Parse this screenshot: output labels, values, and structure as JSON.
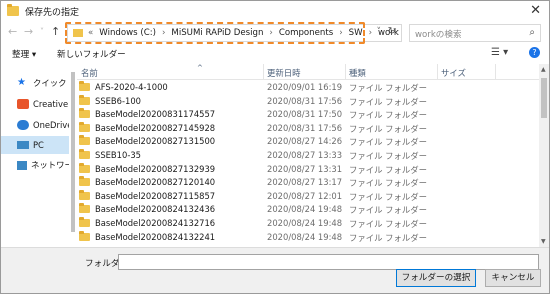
{
  "window": {
    "title": "保存先の指定",
    "close_glyph": "✕"
  },
  "nav": {
    "back": "←",
    "forward": "→",
    "dropdown": "˅",
    "up": "↑",
    "crumb_prefix": "«",
    "crumbs": [
      "Windows (C:)",
      "MiSUMi RAPiD Design",
      "Components",
      "SW",
      "work"
    ],
    "crumb_separator": "›",
    "addr_chevron": "˅",
    "refresh": "↻",
    "search_placeholder": "workの検索",
    "search_icon": "⌕"
  },
  "toolbar": {
    "organize": "整理 ▾",
    "new_folder": "新しいフォルダー",
    "view_icon": "☰ ▾",
    "help_icon": "?"
  },
  "sidebar": {
    "items": [
      {
        "label": "クイック アク",
        "icon": "star-icon",
        "color": "#1a73e8",
        "selected": false
      },
      {
        "label": "Creative Cl",
        "icon": "creative-cloud-icon",
        "color": "#e8552b",
        "selected": false
      },
      {
        "label": "OneDrive -",
        "icon": "cloud-icon",
        "color": "#2b7cd3",
        "selected": false
      },
      {
        "label": "PC",
        "icon": "pc-icon",
        "color": "#3b88c4",
        "selected": true
      },
      {
        "label": "ネットワーク",
        "icon": "network-icon",
        "color": "#3b88c4",
        "selected": false
      }
    ]
  },
  "list": {
    "columns": [
      "名前",
      "更新日時",
      "種類",
      "サイズ"
    ],
    "sort_indicator": "^",
    "rows": [
      {
        "name": "AFS-2020-4-1000",
        "date": "2020/09/01 16:19",
        "type": "ファイル フォルダー"
      },
      {
        "name": "SSEB6-100",
        "date": "2020/08/31 17:56",
        "type": "ファイル フォルダー"
      },
      {
        "name": "BaseModel20200831174557",
        "date": "2020/08/31 17:50",
        "type": "ファイル フォルダー"
      },
      {
        "name": "BaseModel20200827145928",
        "date": "2020/08/31 17:56",
        "type": "ファイル フォルダー"
      },
      {
        "name": "BaseModel20200827131500",
        "date": "2020/08/27 14:26",
        "type": "ファイル フォルダー"
      },
      {
        "name": "SSEB10-35",
        "date": "2020/08/27 13:33",
        "type": "ファイル フォルダー"
      },
      {
        "name": "BaseModel20200827132939",
        "date": "2020/08/27 13:31",
        "type": "ファイル フォルダー"
      },
      {
        "name": "BaseModel20200827120140",
        "date": "2020/08/27 13:17",
        "type": "ファイル フォルダー"
      },
      {
        "name": "BaseModel20200827115857",
        "date": "2020/08/27 12:01",
        "type": "ファイル フォルダー"
      },
      {
        "name": "BaseModel20200824132436",
        "date": "2020/08/24 19:48",
        "type": "ファイル フォルダー"
      },
      {
        "name": "BaseModel20200824132716",
        "date": "2020/08/24 19:48",
        "type": "ファイル フォルダー"
      },
      {
        "name": "BaseModel20200824132241",
        "date": "2020/08/24 19:48",
        "type": "ファイル フォルダー"
      }
    ]
  },
  "footer": {
    "folder_label": "フォルダー:",
    "folder_value": "",
    "select_button": "フォルダーの選択",
    "cancel_button": "キャンセル"
  },
  "colors": {
    "highlight": "#f08a2a",
    "selection": "#cce4f7",
    "folder": "#f0c44c",
    "primary_border": "#0078d7"
  }
}
